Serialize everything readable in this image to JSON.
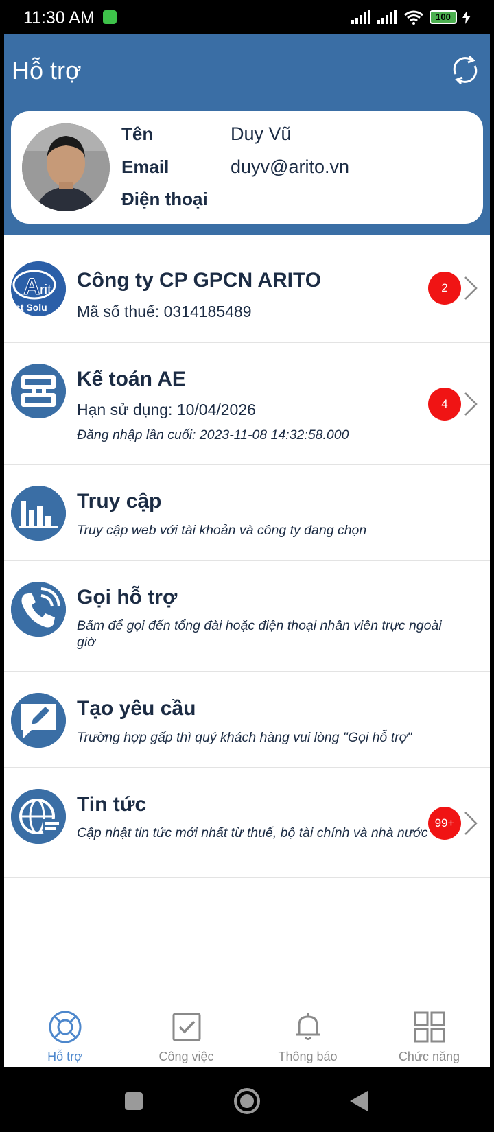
{
  "status_bar": {
    "time": "11:30 AM",
    "battery": "100"
  },
  "header": {
    "title": "Hỗ trợ"
  },
  "profile": {
    "name_label": "Tên",
    "name_value": "Duy Vũ",
    "email_label": "Email",
    "email_value": "duyv@arito.vn",
    "phone_label": "Điện thoại",
    "phone_value": ""
  },
  "menu": [
    {
      "title": "Công ty CP GPCN ARITO",
      "subtitle": "Mã số thuế: 0314185489",
      "badge": "2",
      "icon": "arito-logo"
    },
    {
      "title": "Kế toán AE",
      "subtitle": "Hạn sử dụng: 10/04/2026",
      "note": "Đăng nhập lần cuối: 2023-11-08 14:32:58.000",
      "badge": "4",
      "icon": "ae-logo"
    },
    {
      "title": "Truy cập",
      "description": "Truy cập web với tài khoản và công ty đang chọn",
      "icon": "bar-chart-icon"
    },
    {
      "title": "Gọi hỗ trợ",
      "description": "Bấm để gọi đến tổng đài hoặc điện thoại nhân viên trực ngoài giờ",
      "icon": "phone-icon"
    },
    {
      "title": "Tạo yêu cầu",
      "description": "Trường hợp gấp thì quý khách hàng vui lòng \"Gọi hỗ trợ\"",
      "icon": "edit-message-icon"
    },
    {
      "title": "Tin tức",
      "description": "Cập nhật tin tức mới nhất từ thuế, bộ tài chính và nhà nước",
      "badge": "99+",
      "icon": "globe-news-icon"
    }
  ],
  "bottom_nav": [
    {
      "label": "Hỗ trợ",
      "icon": "lifebuoy-icon",
      "active": true
    },
    {
      "label": "Công việc",
      "icon": "checkbox-icon",
      "active": false
    },
    {
      "label": "Thông báo",
      "icon": "bell-icon",
      "active": false
    },
    {
      "label": "Chức năng",
      "icon": "grid-icon",
      "active": false
    }
  ],
  "colors": {
    "primary": "#3a6ea5",
    "badge": "#f01414",
    "text": "#1c2c44",
    "nav_active": "#4d87cc",
    "nav_inactive": "#8a8a8a"
  }
}
